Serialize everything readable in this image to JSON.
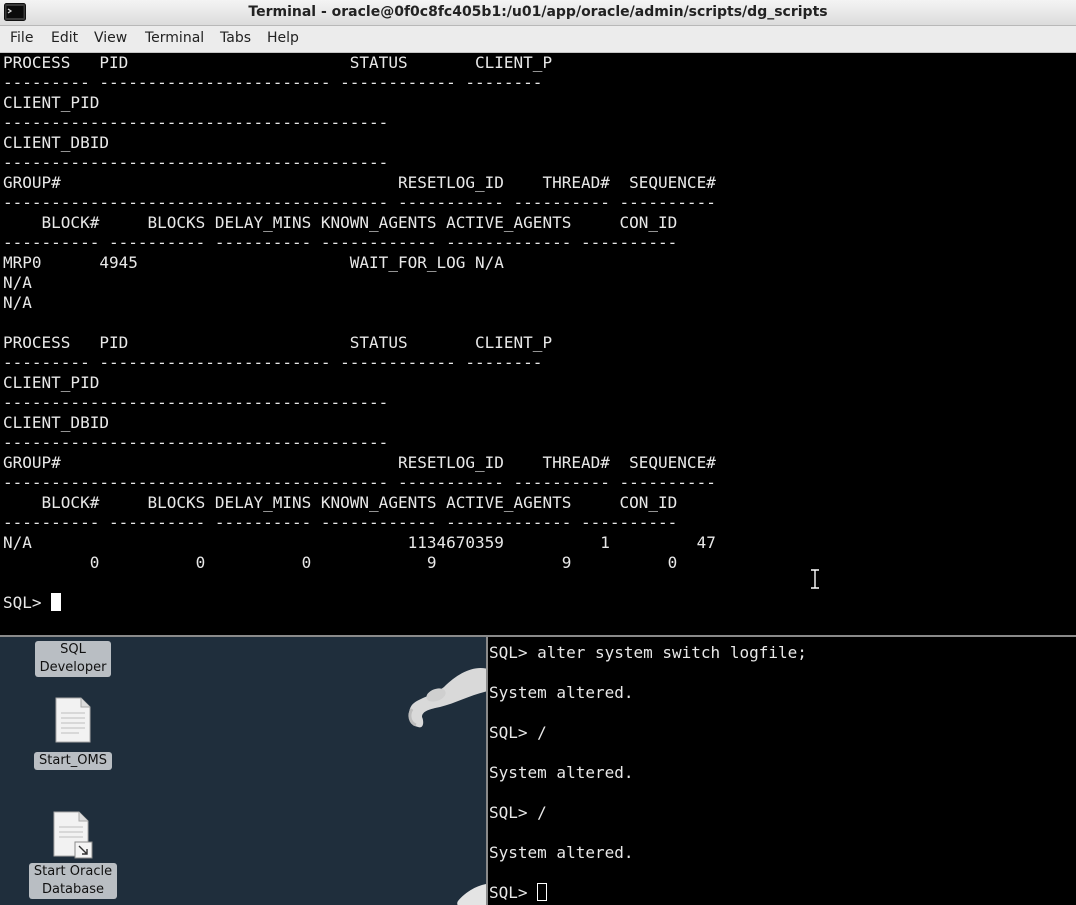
{
  "window": {
    "title": "Terminal - oracle@0f0c8fc405b1:/u01/app/oracle/admin/scripts/dg_scripts",
    "icon": "terminal-icon"
  },
  "menu": {
    "file": "File",
    "edit": "Edit",
    "view": "View",
    "terminal": "Terminal",
    "tabs": "Tabs",
    "help": "Help"
  },
  "terminal": {
    "output": "PROCESS   PID                       STATUS       CLIENT_P\n--------- ------------------------ ------------ --------\nCLIENT_PID\n----------------------------------------\nCLIENT_DBID\n----------------------------------------\nGROUP#                                   RESETLOG_ID    THREAD#  SEQUENCE#\n---------------------------------------- ----------- ---------- ----------\n    BLOCK#     BLOCKS DELAY_MINS KNOWN_AGENTS ACTIVE_AGENTS     CON_ID\n---------- ---------- ---------- ------------ ------------- ----------\nMRP0      4945                      WAIT_FOR_LOG N/A\nN/A\nN/A\n\nPROCESS   PID                       STATUS       CLIENT_P\n--------- ------------------------ ------------ --------\nCLIENT_PID\n----------------------------------------\nCLIENT_DBID\n----------------------------------------\nGROUP#                                   RESETLOG_ID    THREAD#  SEQUENCE#\n---------------------------------------- ----------- ---------- ----------\n    BLOCK#     BLOCKS DELAY_MINS KNOWN_AGENTS ACTIVE_AGENTS     CON_ID\n---------- ---------- ---------- ------------ ------------- ----------\nN/A                                       1134670359          1         47\n         0          0          0            9             9          0\n\n",
    "prompt": "SQL> "
  },
  "desktop": {
    "icons": [
      {
        "label_line1": "SQL",
        "label_line2": "Developer",
        "icon": "sql-developer-icon"
      },
      {
        "label": "Start_OMS",
        "icon": "file-icon"
      },
      {
        "label_line1": "Start Oracle",
        "label_line2": "Database",
        "icon": "launcher-file-icon"
      }
    ]
  },
  "terminal2": {
    "output": "SQL> alter system switch logfile;\n\nSystem altered.\n\nSQL> /\n\nSystem altered.\n\nSQL> /\n\nSystem altered.\n\n",
    "prompt": "SQL> "
  }
}
